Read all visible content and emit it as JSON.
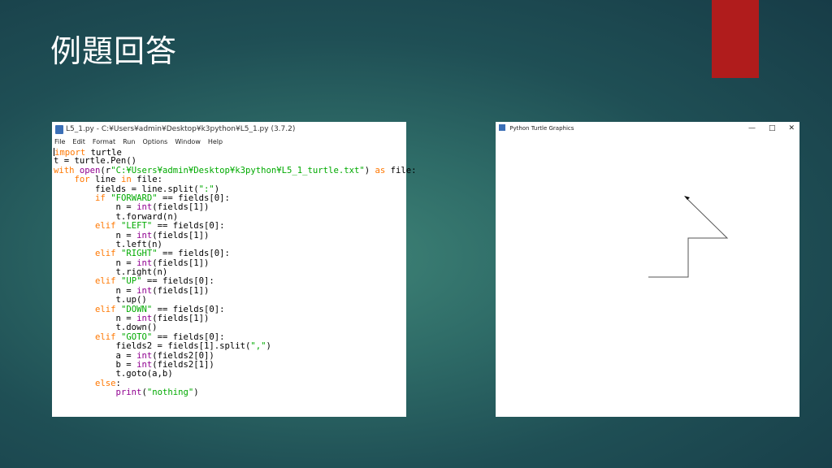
{
  "slide": {
    "title": "例題回答"
  },
  "editor": {
    "title": "L5_1.py - C:¥Users¥admin¥Desktop¥k3python¥L5_1.py (3.7.2)",
    "menu": [
      "File",
      "Edit",
      "Format",
      "Run",
      "Options",
      "Window",
      "Help"
    ],
    "code_lines": [
      [
        {
          "t": "import",
          "c": "kw"
        },
        {
          "t": " turtle"
        }
      ],
      [
        {
          "t": "t = turtle.Pen()"
        }
      ],
      [
        {
          "t": "with",
          "c": "kw"
        },
        {
          "t": " "
        },
        {
          "t": "open",
          "c": "bi"
        },
        {
          "t": "(r"
        },
        {
          "t": "\"C:¥Users¥admin¥Desktop¥k3python¥L5_1_turtle.txt\"",
          "c": "str"
        },
        {
          "t": ") "
        },
        {
          "t": "as",
          "c": "kw"
        },
        {
          "t": " file:"
        }
      ],
      [
        {
          "t": "    "
        },
        {
          "t": "for",
          "c": "kw"
        },
        {
          "t": " line "
        },
        {
          "t": "in",
          "c": "kw"
        },
        {
          "t": " file:"
        }
      ],
      [
        {
          "t": "        fields = line.split("
        },
        {
          "t": "\":\"",
          "c": "str"
        },
        {
          "t": ")"
        }
      ],
      [
        {
          "t": "        "
        },
        {
          "t": "if",
          "c": "kw"
        },
        {
          "t": " "
        },
        {
          "t": "\"FORWARD\"",
          "c": "str"
        },
        {
          "t": " == fields[0]:"
        }
      ],
      [
        {
          "t": "            n = "
        },
        {
          "t": "int",
          "c": "bi"
        },
        {
          "t": "(fields[1])"
        }
      ],
      [
        {
          "t": "            t.forward(n)"
        }
      ],
      [
        {
          "t": "        "
        },
        {
          "t": "elif",
          "c": "kw"
        },
        {
          "t": " "
        },
        {
          "t": "\"LEFT\"",
          "c": "str"
        },
        {
          "t": " == fields[0]:"
        }
      ],
      [
        {
          "t": "            n = "
        },
        {
          "t": "int",
          "c": "bi"
        },
        {
          "t": "(fields[1])"
        }
      ],
      [
        {
          "t": "            t.left(n)"
        }
      ],
      [
        {
          "t": "        "
        },
        {
          "t": "elif",
          "c": "kw"
        },
        {
          "t": " "
        },
        {
          "t": "\"RIGHT\"",
          "c": "str"
        },
        {
          "t": " == fields[0]:"
        }
      ],
      [
        {
          "t": "            n = "
        },
        {
          "t": "int",
          "c": "bi"
        },
        {
          "t": "(fields[1])"
        }
      ],
      [
        {
          "t": "            t.right(n)"
        }
      ],
      [
        {
          "t": "        "
        },
        {
          "t": "elif",
          "c": "kw"
        },
        {
          "t": " "
        },
        {
          "t": "\"UP\"",
          "c": "str"
        },
        {
          "t": " == fields[0]:"
        }
      ],
      [
        {
          "t": "            n = "
        },
        {
          "t": "int",
          "c": "bi"
        },
        {
          "t": "(fields[1])"
        }
      ],
      [
        {
          "t": "            t.up()"
        }
      ],
      [
        {
          "t": "        "
        },
        {
          "t": "elif",
          "c": "kw"
        },
        {
          "t": " "
        },
        {
          "t": "\"DOWN\"",
          "c": "str"
        },
        {
          "t": " == fields[0]:"
        }
      ],
      [
        {
          "t": "            n = "
        },
        {
          "t": "int",
          "c": "bi"
        },
        {
          "t": "(fields[1])"
        }
      ],
      [
        {
          "t": "            t.down()"
        }
      ],
      [
        {
          "t": "        "
        },
        {
          "t": "elif",
          "c": "kw"
        },
        {
          "t": " "
        },
        {
          "t": "\"GOTO\"",
          "c": "str"
        },
        {
          "t": " == fields[0]:"
        }
      ],
      [
        {
          "t": "            fields2 = fields[1].split("
        },
        {
          "t": "\",\"",
          "c": "str"
        },
        {
          "t": ")"
        }
      ],
      [
        {
          "t": "            a = "
        },
        {
          "t": "int",
          "c": "bi"
        },
        {
          "t": "(fields2[0])"
        }
      ],
      [
        {
          "t": "            b = "
        },
        {
          "t": "int",
          "c": "bi"
        },
        {
          "t": "(fields2[1])"
        }
      ],
      [
        {
          "t": "            t.goto(a,b)"
        }
      ],
      [
        {
          "t": "        "
        },
        {
          "t": "else",
          "c": "kw"
        },
        {
          "t": ":"
        }
      ],
      [
        {
          "t": "            "
        },
        {
          "t": "print",
          "c": "bi"
        },
        {
          "t": "("
        },
        {
          "t": "\"nothing\"",
          "c": "str"
        },
        {
          "t": ")"
        }
      ]
    ]
  },
  "turtle_window": {
    "title": "Python Turtle Graphics",
    "controls": {
      "minimize": "—",
      "maximize": "□",
      "close": "✕"
    }
  },
  "colors": {
    "keyword": "#ff7700",
    "builtin": "#900090",
    "string": "#00aa00",
    "accent_red": "#b01c1c"
  }
}
